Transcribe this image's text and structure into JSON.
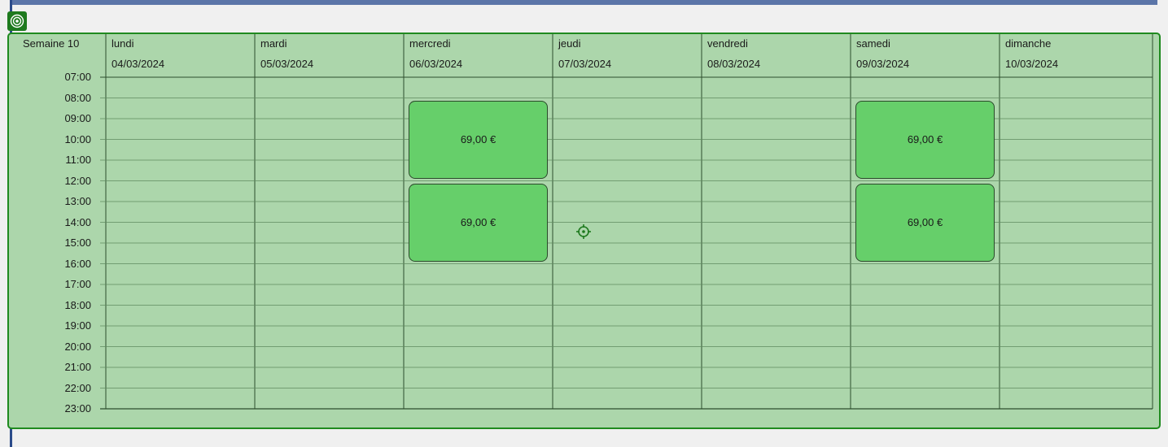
{
  "week_label": "Semaine 10",
  "days": [
    {
      "name": "lundi",
      "date": "04/03/2024"
    },
    {
      "name": "mardi",
      "date": "05/03/2024"
    },
    {
      "name": "mercredi",
      "date": "06/03/2024"
    },
    {
      "name": "jeudi",
      "date": "07/03/2024"
    },
    {
      "name": "vendredi",
      "date": "08/03/2024"
    },
    {
      "name": "samedi",
      "date": "09/03/2024"
    },
    {
      "name": "dimanche",
      "date": "10/03/2024"
    }
  ],
  "hours": [
    "07:00",
    "08:00",
    "09:00",
    "10:00",
    "11:00",
    "12:00",
    "13:00",
    "14:00",
    "15:00",
    "16:00",
    "17:00",
    "18:00",
    "19:00",
    "20:00",
    "21:00",
    "22:00",
    "23:00"
  ],
  "events": [
    {
      "day": 2,
      "start": "08:00",
      "end": "12:00",
      "label": "69,00 €"
    },
    {
      "day": 2,
      "start": "12:00",
      "end": "16:00",
      "label": "69,00 €"
    },
    {
      "day": 5,
      "start": "08:00",
      "end": "12:00",
      "label": "69,00 €"
    },
    {
      "day": 5,
      "start": "12:00",
      "end": "16:00",
      "label": "69,00 €"
    }
  ],
  "colors": {
    "panel_bg": "#acd6ab",
    "panel_border": "#1f8a1f",
    "event_bg": "#66cf6a",
    "accent_blue": "#5b75a8"
  },
  "icons": {
    "corner": "target-icon",
    "cursor": "crosshair-icon"
  }
}
